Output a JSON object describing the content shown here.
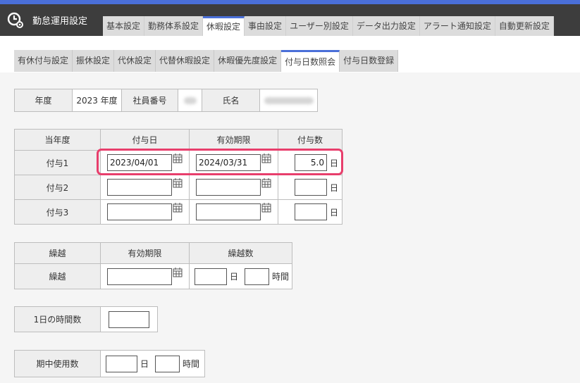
{
  "header": {
    "app_title": "勤怠運用設定",
    "tabs": [
      "基本設定",
      "勤務体系設定",
      "休暇設定",
      "事由設定",
      "ユーザー別設定",
      "データ出力設定",
      "アラート通知設定",
      "自動更新設定"
    ],
    "active_tab": 2
  },
  "sub_tabs": {
    "items": [
      "有休付与設定",
      "振休設定",
      "代休設定",
      "代替休暇設定",
      "休暇優先度設定",
      "付与日数照会",
      "付与日数登録"
    ],
    "active": 5
  },
  "info": {
    "year_label": "年度",
    "year_value": "2023 年度",
    "employee_no_label": "社員番号",
    "name_label": "氏名"
  },
  "grant_table": {
    "headers": [
      "当年度",
      "付与日",
      "有効期限",
      "付与数"
    ],
    "rows": [
      {
        "label": "付与1",
        "grant_date": "2023/04/01",
        "expiry": "2024/03/31",
        "days": "5.0"
      },
      {
        "label": "付与2",
        "grant_date": "",
        "expiry": "",
        "days": ""
      },
      {
        "label": "付与3",
        "grant_date": "",
        "expiry": "",
        "days": ""
      }
    ],
    "unit_day": "日"
  },
  "carry_table": {
    "headers": [
      "繰越",
      "有効期限",
      "繰越数"
    ],
    "row_label": "繰越",
    "unit_day": "日",
    "unit_hour": "時間"
  },
  "hours_per_day": {
    "label": "1日の時間数",
    "value": ""
  },
  "period_use": {
    "label": "期中使用数",
    "unit_day": "日",
    "unit_hour": "時間"
  }
}
